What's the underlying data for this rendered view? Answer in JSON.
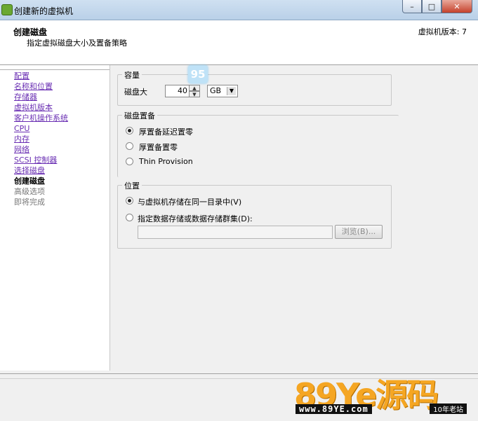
{
  "window": {
    "title": "创建新的虚拟机",
    "minimize": "–",
    "maximize": "□",
    "close": "✕"
  },
  "header": {
    "title": "创建磁盘",
    "subtitle": "指定虚拟磁盘大小及置备策略",
    "version": "虚拟机版本: 7"
  },
  "nav": [
    {
      "label": "配置",
      "state": "link"
    },
    {
      "label": "名称和位置",
      "state": "link"
    },
    {
      "label": "存储器",
      "state": "link"
    },
    {
      "label": "虚拟机版本",
      "state": "link"
    },
    {
      "label": "客户机操作系统",
      "state": "link"
    },
    {
      "label": "CPU",
      "state": "link"
    },
    {
      "label": "内存",
      "state": "link"
    },
    {
      "label": "网络",
      "state": "link"
    },
    {
      "label": "SCSI 控制器",
      "state": "link"
    },
    {
      "label": "选择磁盘",
      "state": "link"
    },
    {
      "label": "创建磁盘",
      "state": "current"
    },
    {
      "label": "高级选项",
      "state": "disabled"
    },
    {
      "label": "即将完成",
      "state": "disabled"
    }
  ],
  "capacity": {
    "legend": "容量",
    "disk_size_label": "磁盘大",
    "disk_size_value": "40",
    "unit": "GB"
  },
  "provisioning": {
    "legend": "磁盘置备",
    "options": [
      {
        "label": "厚置备延迟置零",
        "checked": true
      },
      {
        "label": "厚置备置零",
        "checked": false
      },
      {
        "label": "Thin Provision",
        "checked": false
      }
    ]
  },
  "location": {
    "legend": "位置",
    "option_same": "与虚拟机存储在同一目录中(V)",
    "option_specify": "指定数据存储或数据存储群集(D):",
    "path_value": "",
    "browse_label": "浏览(B)..."
  },
  "overlay": {
    "tip_glyph": "95"
  },
  "watermark": {
    "brand": "89Ye源码",
    "url": "www.89YE.com",
    "tag": "10年老站"
  }
}
